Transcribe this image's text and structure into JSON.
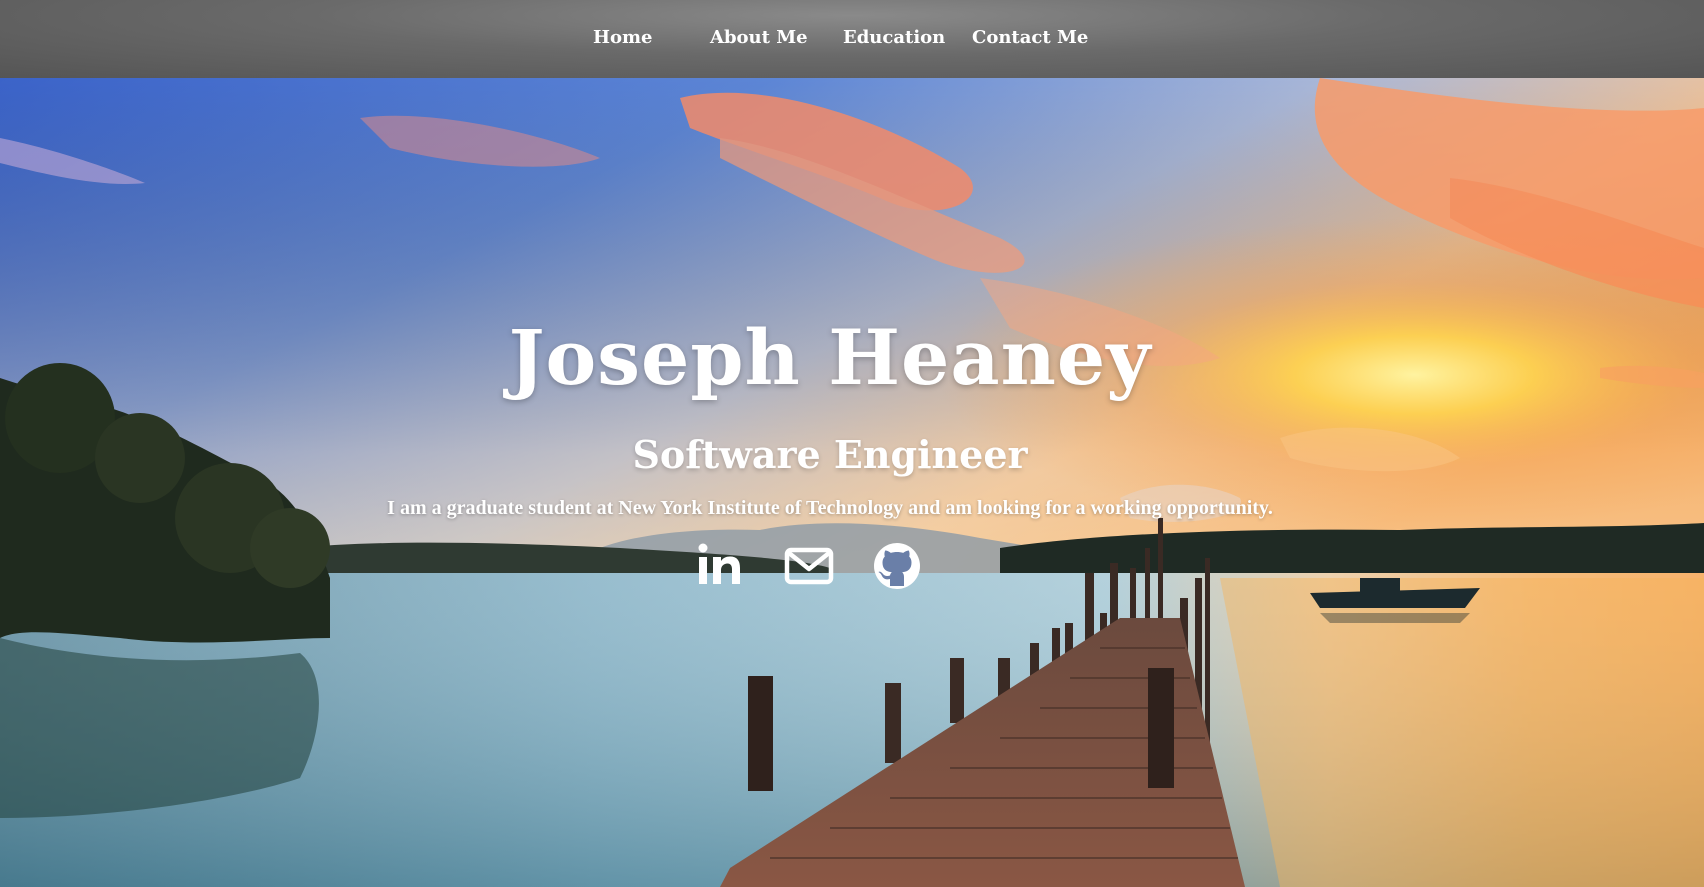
{
  "nav": {
    "items": [
      {
        "label": "Home"
      },
      {
        "label": "About Me"
      },
      {
        "label": "Education"
      },
      {
        "label": "Contact Me"
      }
    ]
  },
  "hero": {
    "name": "Joseph Heaney",
    "title": "Software Engineer",
    "description": "I am a graduate student at New York Institute of Technology and am looking for a working opportunity.",
    "social": [
      {
        "icon": "linkedin-icon"
      },
      {
        "icon": "email-icon"
      },
      {
        "icon": "github-icon"
      }
    ]
  },
  "colors": {
    "nav_background": "#666666",
    "text": "#ffffff"
  }
}
